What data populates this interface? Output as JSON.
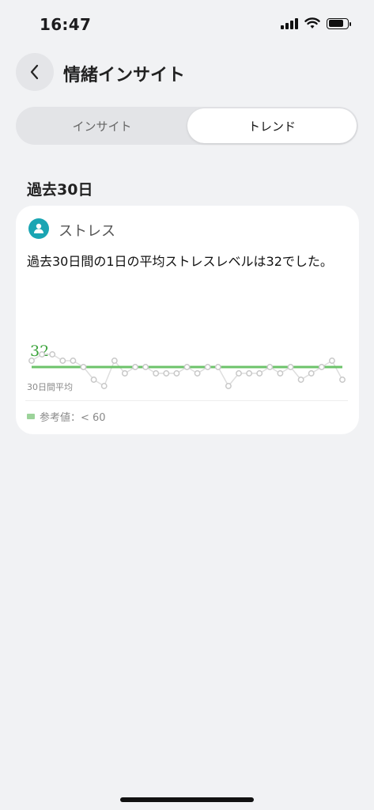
{
  "status_bar": {
    "time": "16:47"
  },
  "header": {
    "title": "情緒インサイト"
  },
  "tabs": [
    {
      "label": "インサイト"
    },
    {
      "label": "トレンド"
    }
  ],
  "section": {
    "title": "過去30日"
  },
  "card": {
    "metric": "ストレス",
    "summary": "過去30日間の1日の平均ストレスレベルは32でした。",
    "legend": "参考値：< 60",
    "colors": {
      "average_line": "#6cc36a",
      "points": "#c8c8c8",
      "label": "#3aa33a"
    }
  },
  "chart_data": {
    "type": "line",
    "title": "",
    "average": 32,
    "average_label": "32",
    "average_caption": "30日間平均",
    "series": [
      {
        "values": [
          33,
          34,
          34,
          33,
          33,
          32,
          30,
          29,
          33,
          31,
          32,
          32,
          31,
          31,
          31,
          32,
          31,
          32,
          32,
          29,
          31,
          31,
          31,
          32,
          31,
          32,
          30,
          31,
          32,
          33,
          30
        ]
      }
    ],
    "ylim": [
      20,
      40
    ]
  }
}
